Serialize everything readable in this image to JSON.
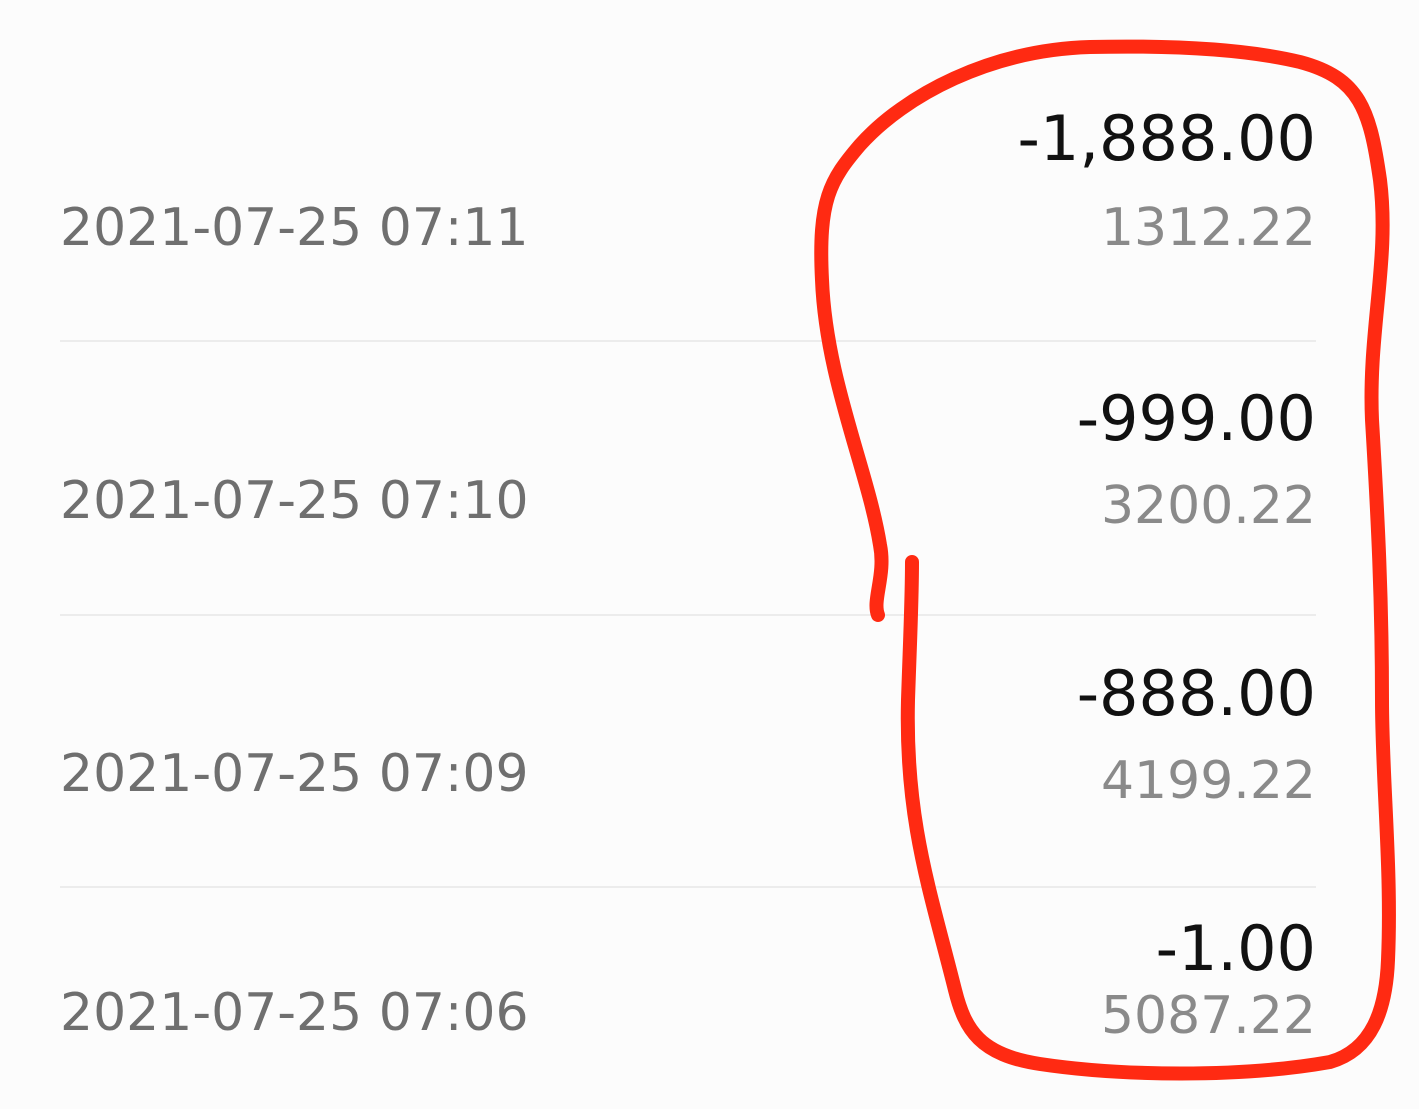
{
  "transactions": [
    {
      "datetime": "2021-07-25 07:11",
      "amount": "-1,888.00",
      "balance": "1312.22"
    },
    {
      "datetime": "2021-07-25 07:10",
      "amount": "-999.00",
      "balance": "3200.22"
    },
    {
      "datetime": "2021-07-25 07:09",
      "amount": "-888.00",
      "balance": "4199.22"
    },
    {
      "datetime": "2021-07-25 07:06",
      "amount": "-1.00",
      "balance": "5087.22"
    }
  ],
  "colors": {
    "background": "#fcfcfc",
    "date_text": "#6f6f6f",
    "amount_text": "#111111",
    "balance_text": "#8a8a8a",
    "divider": "#ececec",
    "annotation_stroke": "#ff2a12"
  },
  "annotation": {
    "shape": "hand-drawn-loop-around-amounts"
  }
}
